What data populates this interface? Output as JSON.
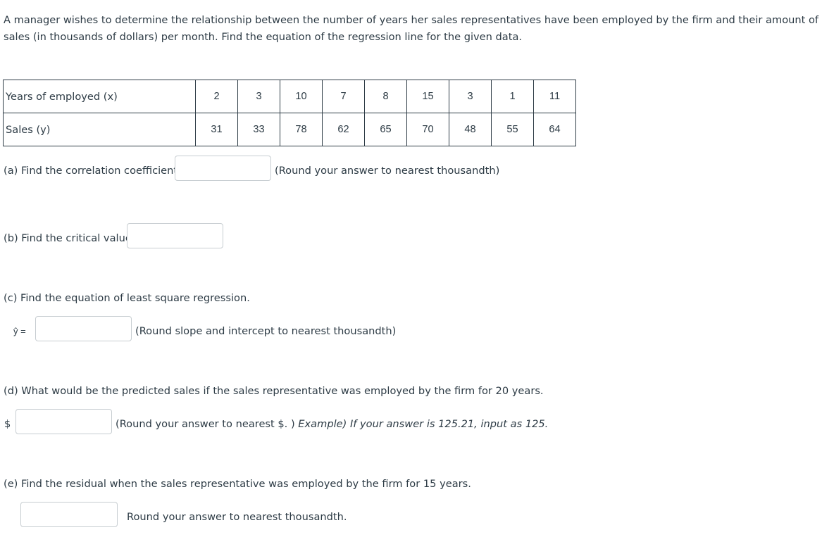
{
  "question": {
    "intro": "A manager wishes to determine the relationship between the number of years her sales representatives have been employed by the firm and their amount of sales (in thousands of dollars) per month. Find the equation of the regression line for the given data."
  },
  "table": {
    "rows": [
      {
        "label": "Years of employed (x)",
        "values": [
          "2",
          "3",
          "10",
          "7",
          "8",
          "15",
          "3",
          "1",
          "11"
        ]
      },
      {
        "label": "Sales (y)",
        "values": [
          "31",
          "33",
          "78",
          "62",
          "65",
          "70",
          "48",
          "55",
          "64"
        ]
      }
    ]
  },
  "parts": {
    "a": {
      "label": "(a) Find the correlation  coefficient",
      "value": "",
      "hint": "(Round your answer to nearest thousandth)"
    },
    "b": {
      "label": "(b) Find the critical value",
      "value": ""
    },
    "c": {
      "label": "(c) Find the equation of least square regression.",
      "yhat_label": "ŷ =",
      "value": "",
      "hint": "(Round slope and intercept to nearest thousandth)"
    },
    "d": {
      "label": "(d) What would be the predicted sales if the sales representative was employed by the firm for 20 years.",
      "currency": "$",
      "value": "",
      "hint_plain": "(Round your answer to nearest $. ) ",
      "hint_italic": "Example) If your answer is 125.21, input as 125."
    },
    "e": {
      "label": "(e) Find the residual when the sales representative was employed by the firm for 15 years.",
      "value": "",
      "hint": "Round your answer to nearest thousandth."
    }
  }
}
